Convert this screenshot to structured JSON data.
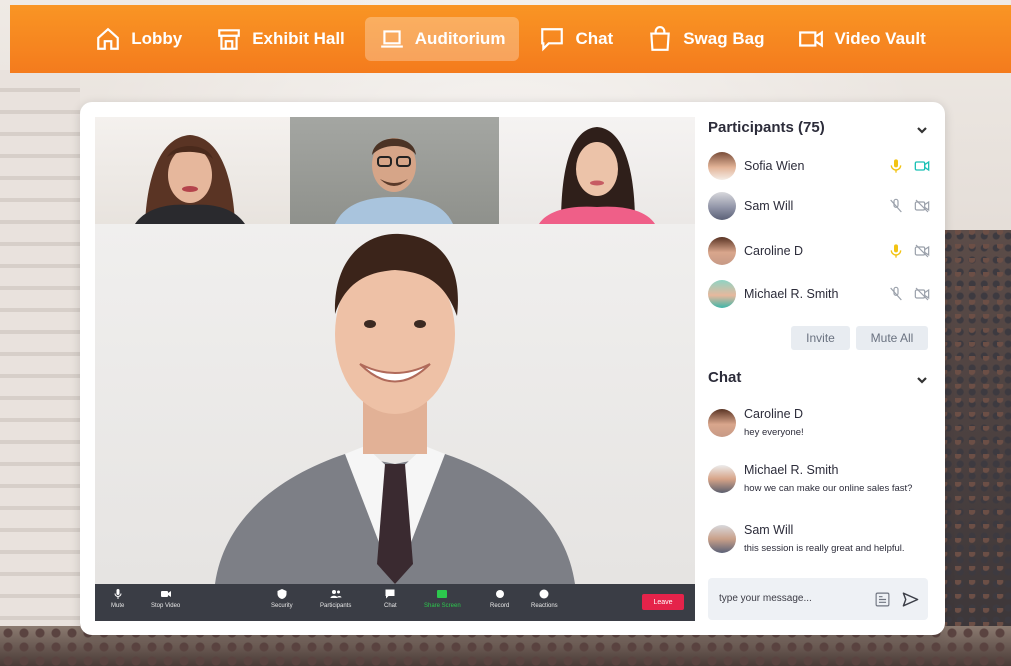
{
  "nav": {
    "items": [
      {
        "label": "Lobby",
        "icon": "home-icon"
      },
      {
        "label": "Exhibit Hall",
        "icon": "store-icon"
      },
      {
        "label": "Auditorium",
        "icon": "laptop-icon",
        "active": true
      },
      {
        "label": "Chat",
        "icon": "chat-bubble-icon"
      },
      {
        "label": "Swag Bag",
        "icon": "shopping-bag-icon"
      },
      {
        "label": "Video Vault",
        "icon": "video-camera-icon"
      }
    ]
  },
  "controls": {
    "mute": "Mute",
    "stop_video": "Stop Video",
    "security": "Security",
    "participants": "Participants",
    "chat": "Chat",
    "share_screen": "Share Screen",
    "record": "Record",
    "reactions": "Reactions",
    "leave": "Leave"
  },
  "participants": {
    "title": "Participants (75)",
    "list": [
      {
        "name": "Sofia Wien",
        "mic": "on",
        "cam": "on"
      },
      {
        "name": "Sam Will",
        "mic": "off",
        "cam": "off"
      },
      {
        "name": "Caroline D",
        "mic": "on",
        "cam": "off"
      },
      {
        "name": "Michael R. Smith",
        "mic": "off",
        "cam": "off"
      }
    ],
    "invite": "Invite",
    "mute_all": "Mute All"
  },
  "chat": {
    "title": "Chat",
    "messages": [
      {
        "name": "Caroline D",
        "text": "hey everyone!"
      },
      {
        "name": "Michael R. Smith",
        "text": "how we can make our online sales fast?"
      },
      {
        "name": "Sam Will",
        "text": "this session is really great and helpful."
      }
    ],
    "input_placeholder": "type your message..."
  },
  "colors": {
    "accent_orange": "#f7891f",
    "mic_on": "#f2c313",
    "cam_on": "#1bc1b5",
    "leave": "#e5234a",
    "share": "#2cc84d"
  }
}
